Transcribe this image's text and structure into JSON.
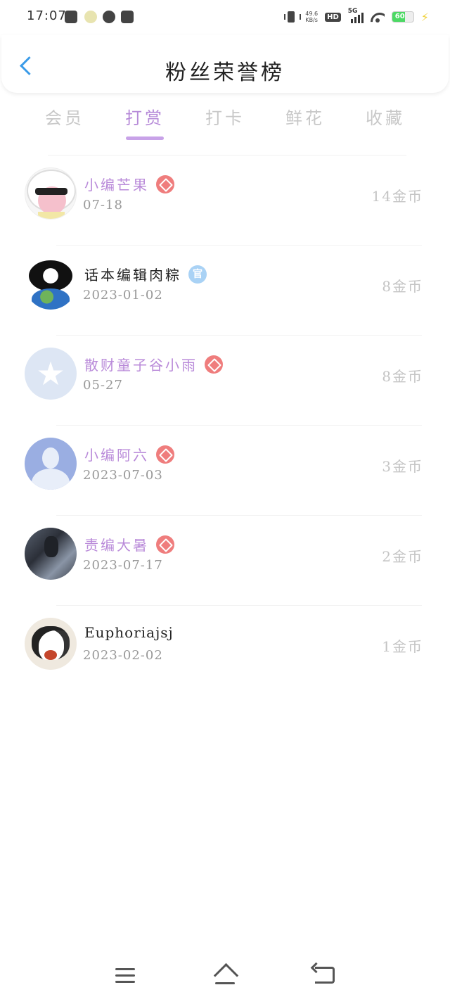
{
  "status_bar": {
    "time": "17:07",
    "net_speed_value": "49.6",
    "net_speed_unit": "KB/s",
    "hd_label": "HD",
    "network_label": "5G",
    "battery_level": "60",
    "icons": [
      "app-notification-icon",
      "weather-icon",
      "link-icon",
      "music-icon",
      "vibrate-icon",
      "wifi-icon",
      "battery-icon",
      "charging-icon"
    ]
  },
  "header": {
    "title": "粉丝荣誉榜",
    "back_icon": "chevron-left-icon",
    "accent_color": "#3a9be8"
  },
  "tabs": [
    {
      "label": "会员",
      "active": false
    },
    {
      "label": "打赏",
      "active": true
    },
    {
      "label": "打卡",
      "active": false
    },
    {
      "label": "鲜花",
      "active": false
    },
    {
      "label": "收藏",
      "active": false
    }
  ],
  "tab_active_color": "#b68ad8",
  "fans": [
    {
      "name": "小编芒果",
      "badge": "diamond",
      "date": "07-18",
      "coins": "14金币"
    },
    {
      "name": "话本编辑肉粽",
      "badge": "official",
      "badge_text": "官",
      "date": "2023-01-02",
      "coins": "8金币"
    },
    {
      "name": "散财童子谷小雨",
      "badge": "diamond",
      "date": "05-27",
      "coins": "8金币"
    },
    {
      "name": "小编阿六",
      "badge": "diamond",
      "date": "2023-07-03",
      "coins": "3金币"
    },
    {
      "name": "责编大暑",
      "badge": "diamond",
      "date": "2023-07-17",
      "coins": "2金币"
    },
    {
      "name": "Euphoriajsj",
      "badge": "none",
      "date": "2023-02-02",
      "coins": "1金币"
    }
  ],
  "colors": {
    "vip_name": "#b98ad9",
    "diamond_badge": "#ef7d7d",
    "official_badge": "#a9d2f5"
  },
  "bottom_nav": {
    "icons": [
      "menu-icon",
      "home-icon",
      "back-icon"
    ]
  }
}
